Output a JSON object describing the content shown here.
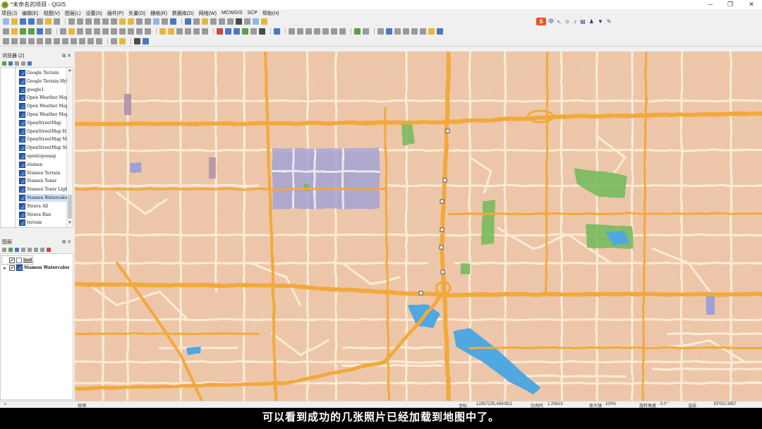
{
  "window": {
    "title": "*未命名的项目 - QGIS"
  },
  "menu": [
    "项目(J)",
    "编辑(E)",
    "视图(V)",
    "图层(L)",
    "设置(S)",
    "插件(P)",
    "矢量(O)",
    "栅格(R)",
    "数据库(D)",
    "网络(W)",
    "MCWGIS",
    "SCP",
    "帮助(H)"
  ],
  "ime": {
    "logo": "S",
    "label": "中"
  },
  "browser_panel": {
    "title": "浏览器 (2)",
    "items": [
      "Google Terrain",
      "Google Terrain Hybrid",
      "google1",
      "Open Weather Map Clouds",
      "Open Weather Map Precip",
      "Open Weather Map Temp",
      "OpenStreetMap",
      "OpenStreetMap H.O.T.",
      "OpenStreetMap Monochrome",
      "OpenStreetMap Standard",
      "opentopomap",
      "stamen",
      "Stamen Terrain",
      "Stamen Toner",
      "Stamen Toner Light",
      "Stamen Watercolor",
      "Strava All",
      "Strava Run",
      "terrain"
    ],
    "selected_index": 15
  },
  "layers_panel": {
    "title": "图层",
    "layers": [
      {
        "name": "test",
        "checked": true,
        "type": "points"
      },
      {
        "name": "Stamen Watercolor",
        "checked": true,
        "type": "raster"
      }
    ]
  },
  "status": {
    "left": "就绪",
    "coordinate_label": "坐标",
    "coordinate": "12957235,4850811",
    "scale_label": "比例尺",
    "scale": "1:25615",
    "magnifier_label": "放大镜",
    "magnifier": "100%",
    "rotation_label": "旋转角度",
    "rotation": "0.0 °",
    "render_label": "渲染",
    "crs": "EPSG:3857"
  },
  "subtitle": "可以看到成功的几张照片已经加载到地图中了。",
  "colors": {
    "map_base": "#edc7a9",
    "road_major": "#f2a93b",
    "road_minor": "#fbecd6",
    "water": "#4fa8e0",
    "park": "#6fbb5a",
    "block_purple": "#9fa0d6"
  }
}
